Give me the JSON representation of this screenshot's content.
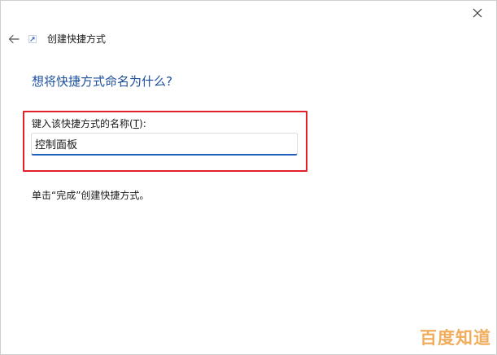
{
  "wizard": {
    "title": "创建快捷方式",
    "question": "想将快捷方式命名为什么?",
    "field_label_prefix": "键入该快捷方式的名称(",
    "field_label_accel": "T",
    "field_label_suffix": "):",
    "name_value": "控制面板",
    "hint": "单击“完成”创建快捷方式。"
  },
  "icons": {
    "close": "close-icon",
    "back": "back-arrow-icon",
    "wizard": "shortcut-icon"
  },
  "watermark": "百度知道",
  "colors": {
    "question_blue": "#1b4f9c",
    "highlight_red": "#e2202b",
    "input_focus_blue": "#1f5fbf"
  }
}
